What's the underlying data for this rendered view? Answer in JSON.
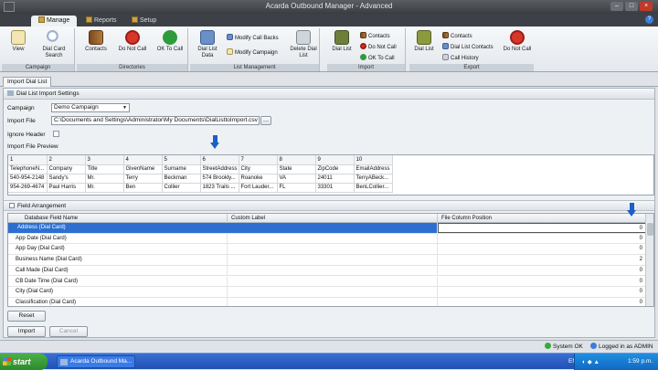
{
  "window": {
    "title": "Acarda Outbound Manager - Advanced"
  },
  "tabs": [
    {
      "label": "Manage"
    },
    {
      "label": "Reports"
    },
    {
      "label": "Setup"
    }
  ],
  "ribbon": {
    "campaign": {
      "label": "Campaign",
      "view": "View",
      "dial_card_search": "Dial Card Search"
    },
    "directories": {
      "label": "Directories",
      "contacts": "Contacts",
      "do_not_call": "Do Not Call",
      "ok_to_call": "OK To Call"
    },
    "list_management": {
      "label": "List Management",
      "dial_list_data": "Dial List Data",
      "modify_call_backs": "Modify Call Backs",
      "modify_campaign": "Modify Campaign",
      "delete_dial_list": "Delete Dial List"
    },
    "import": {
      "label": "Import",
      "dial_list": "Dial List",
      "contacts": "Contacts",
      "do_not_call": "Do Not Call",
      "ok_to_call": "OK To Call"
    },
    "export": {
      "label": "Export",
      "dial_list": "Dial List",
      "contacts": "Contacts",
      "dial_list_contacts": "Dial List Contacts",
      "call_history": "Call History",
      "do_not_call": "Do Not Call"
    }
  },
  "doc_tab": "Import Dial List",
  "settings": {
    "header": "Dial List Import Settings",
    "campaign_label": "Campaign",
    "campaign_value": "Demo Campaign",
    "import_file_label": "Import File",
    "import_file_value": "C:\\Documents and Settings\\Administrator\\My Documents\\DialListtoImport.csv",
    "ignore_header_label": "Ignore Header",
    "preview_label": "Import File Preview"
  },
  "preview": {
    "numbers": [
      "1",
      "2",
      "3",
      "4",
      "5",
      "6",
      "7",
      "8",
      "9",
      "10"
    ],
    "rows": [
      [
        "TelephoneN...",
        "Company",
        "Title",
        "GivenName",
        "Surname",
        "StreetAddress",
        "City",
        "State",
        "ZipCode",
        "EmailAddress"
      ],
      [
        "540-954-2148",
        "Sandy's",
        "Mr.",
        "Terry",
        "Beckman",
        "574 Brookly...",
        "Roanoke",
        "VA",
        "24011",
        "TerryABeck..."
      ],
      [
        "954-269-4674",
        "Paul Harris",
        "Mr.",
        "Ben",
        "Collier",
        "1823 Trails ...",
        "Fort Lauder...",
        "FL",
        "33301",
        "BenLCollier..."
      ]
    ]
  },
  "field_arrangement": {
    "header": "Field Arrangement",
    "columns": [
      "Database Field Name",
      "Custom Label",
      "File Column Position"
    ],
    "rows": [
      {
        "name": "Address (Dial Card)",
        "label": "",
        "pos": "0"
      },
      {
        "name": "App Date (Dial Card)",
        "label": "",
        "pos": "0"
      },
      {
        "name": "App Day (Dial Card)",
        "label": "",
        "pos": "0"
      },
      {
        "name": "Business Name (Dial Card)",
        "label": "",
        "pos": "2"
      },
      {
        "name": "Call Made (Dial Card)",
        "label": "",
        "pos": "0"
      },
      {
        "name": "CB Date Time (Dial Card)",
        "label": "",
        "pos": "0"
      },
      {
        "name": "City (Dial Card)",
        "label": "",
        "pos": "0"
      },
      {
        "name": "Classification (Dial Card)",
        "label": "",
        "pos": "0"
      }
    ]
  },
  "buttons": {
    "reset": "Reset",
    "import": "Import",
    "cancel": "Cancel"
  },
  "status": {
    "system": "System OK",
    "logged": "Logged in as ADMIN"
  },
  "taskbar": {
    "start": "start",
    "app": "Acarda Outbound Ma...",
    "lang": "EN",
    "time": "1:59 p.m."
  }
}
